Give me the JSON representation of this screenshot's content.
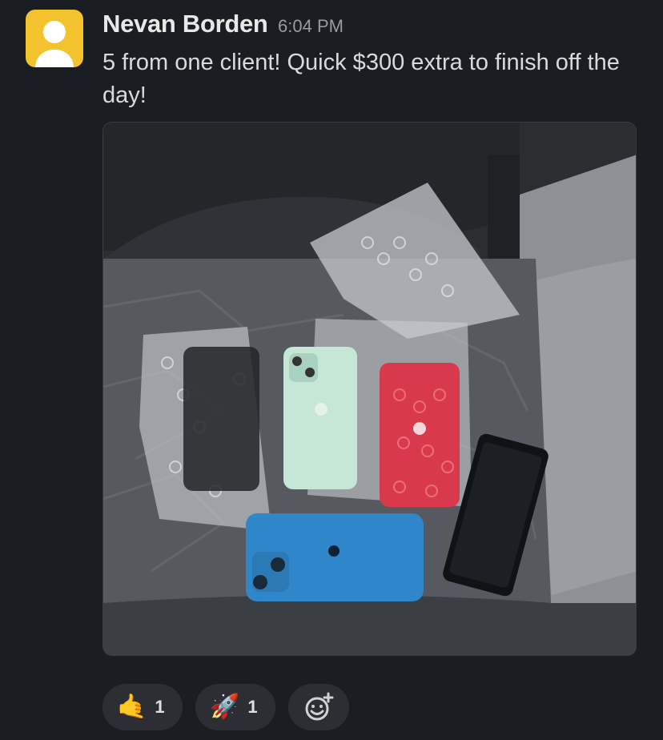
{
  "message": {
    "sender": "Nevan Borden",
    "timestamp": "6:04 PM",
    "text": "5 from one client! Quick $300 extra to finish off the day!"
  },
  "attachment": {
    "alt": "five phones in bubble wrap on a car seat"
  },
  "reactions": [
    {
      "emoji": "🤙",
      "icon": "call-me-hand-icon",
      "count": "1"
    },
    {
      "emoji": "🚀",
      "icon": "rocket-icon",
      "count": "1"
    }
  ],
  "add_reaction": {
    "icon": "add-emoji-icon"
  },
  "colors": {
    "background": "#1a1d21",
    "avatar": "#f2c32c",
    "reaction_pill": "#2c2e33"
  }
}
